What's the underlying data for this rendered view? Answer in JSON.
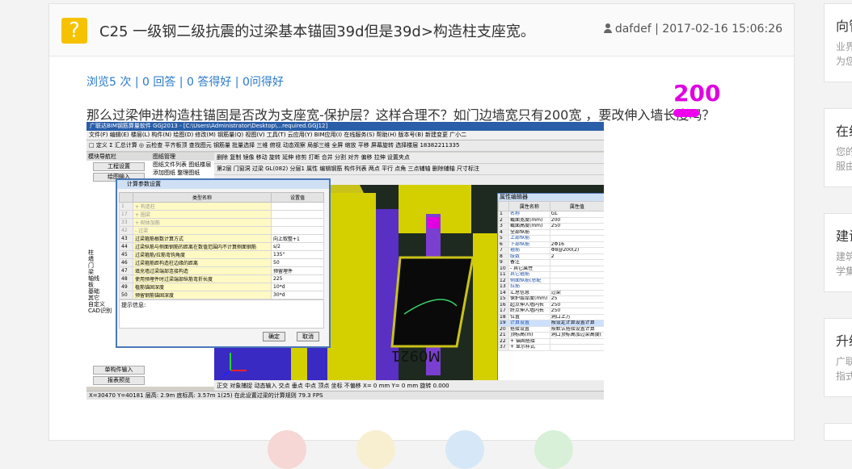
{
  "question": {
    "title": "C25 一级钢二级抗震的过梁基本锚固39d但是39d>构造柱支座宽。",
    "author": "dafdef",
    "separator": "|",
    "datetime": "2017-02-16 15:06:26",
    "stats": {
      "views": "浏览5 次",
      "answers": "0 回答",
      "good_answers": "0 答得好",
      "helpful": "0问得好",
      "sep": "|"
    },
    "body": "那么过梁伸进构造柱锚固是否改为支座宽-保护层？这样合理不？如门边墙宽只有200宽 ，要改伸入墙长度吗？",
    "annotation": "200"
  },
  "screenshot": {
    "titlebar": "广联达BIM钢筋算量软件 GGJ2013 - [C:\\Users\\Administrator\\Desktop\\...required.GGJ12]",
    "menubar": "文件(F)  编辑(E)  楼层(L)  构件(N)  绘图(D)  修改(M)  钢筋量(Q)  视图(V)  工具(T)  云应用(Y)  BIM应用(I)  在线服务(S)  帮助(H)  版本号(B)  新建变更  广小二",
    "toolbar1": "□ 定义  Σ 汇总计算  ◎ 云检查  平齐板顶  查找图元  钢筋量  批量选择  三维  俯视  动态观察  局部三维  全屏  缩放  平移  屏幕旋转  选择楼层",
    "phone": "18382211335",
    "leftpanel": {
      "header": "模块导航栏",
      "btn1": "工程设置",
      "btn2": "绘图输入",
      "tree": [
        "柱",
        "墙",
        "门",
        "梁",
        "轴线",
        "板",
        "基础",
        "其它",
        "自定义",
        "CAD识别"
      ],
      "bottom1": "单构件输入",
      "bottom2": "报表预览"
    },
    "midpanel": {
      "header": "图纸管理",
      "row": "图纸文件列表  图纸楼层",
      "btn": "添加图纸  整理图纸"
    },
    "vptoolbar": {
      "row1": "删除  复制  镜像  移动  旋转  延伸  修剪  打断  合并  分割  对齐  偏移  拉伸  设置夹点",
      "row2": "第2层  门窗洞  过梁  GL(082)  分层1  属性  编辑钢筋  构件列表  两点  平行  点角  三点辅轴  删除辅轴  尺寸标注"
    },
    "dialog": {
      "title": "计算参数设置",
      "col_name": "类型名称",
      "col_value": "设置值",
      "rows": [
        {
          "id": "1",
          "name": "+ 构造柱",
          "value": "",
          "group": true
        },
        {
          "id": "17",
          "name": "+ 圈梁",
          "value": "",
          "group": true
        },
        {
          "id": "33",
          "name": "+ 砌体加筋",
          "value": "",
          "group": true
        },
        {
          "id": "42",
          "name": "- 过梁",
          "value": "",
          "group": true
        },
        {
          "id": "43",
          "name": "过梁箍筋根数计算方式",
          "value": "向上取整+1"
        },
        {
          "id": "44",
          "name": "过梁纵筋与侧面钢筋的距离在数值范围内不计算侧面钢筋",
          "value": "s/2"
        },
        {
          "id": "45",
          "name": "过梁箍筋/拉筋弯钩角度",
          "value": "135°"
        },
        {
          "id": "46",
          "name": "过梁箍筋距构造柱边缘的距离",
          "value": "50"
        },
        {
          "id": "47",
          "name": "填充墙过梁端部连接构造",
          "value": "预留埋件"
        },
        {
          "id": "48",
          "name": "使用预埋件时过梁端部纵筋弯折长度",
          "value": "225"
        },
        {
          "id": "49",
          "name": "植筋锚固深度",
          "value": "10*d"
        },
        {
          "id": "50",
          "name": "预留钢筋锚固深度",
          "value": "30*d"
        }
      ],
      "hint": "提示信息:",
      "ok": "确定",
      "cancel": "取消"
    },
    "props": {
      "title": "属性编辑器",
      "col_name": "属性名称",
      "col_value": "属性值",
      "rows": [
        {
          "i": "1",
          "n": "名称",
          "v": "GL",
          "b": true
        },
        {
          "i": "2",
          "n": "截面宽度(mm)",
          "v": "200",
          "b": false
        },
        {
          "i": "3",
          "n": "截面高度(mm)",
          "v": "250",
          "b": false
        },
        {
          "i": "4",
          "n": "全部纵筋",
          "v": "",
          "b": false
        },
        {
          "i": "5",
          "n": "上部纵筋",
          "v": "",
          "b": true
        },
        {
          "i": "6",
          "n": "下部纵筋",
          "v": "2Φ16",
          "b": true
        },
        {
          "i": "7",
          "n": "箍筋",
          "v": "Φ8@200(2)",
          "b": true
        },
        {
          "i": "8",
          "n": "肢数",
          "v": "2",
          "b": true
        },
        {
          "i": "9",
          "n": "备注",
          "v": "",
          "b": false
        },
        {
          "i": "10",
          "n": "- 其它属性",
          "v": "",
          "b": false
        },
        {
          "i": "11",
          "n": "其它箍筋",
          "v": "",
          "b": true
        },
        {
          "i": "12",
          "n": "侧面纵筋(总配",
          "v": "",
          "b": true
        },
        {
          "i": "13",
          "n": "拉筋",
          "v": "",
          "b": true
        },
        {
          "i": "14",
          "n": "汇总信息",
          "v": "过梁",
          "b": false
        },
        {
          "i": "15",
          "n": "保护层厚度(mm)",
          "v": "25",
          "b": false
        },
        {
          "i": "16",
          "n": "起点伸入墙内长",
          "v": "250",
          "b": false
        },
        {
          "i": "17",
          "n": "终点伸入墙内长",
          "v": "250",
          "b": false
        },
        {
          "i": "18",
          "n": "位置",
          "v": "洞口上方",
          "b": false
        },
        {
          "i": "19",
          "n": "计算设置",
          "v": "按设定计算设置计算",
          "b": true,
          "sel": true
        },
        {
          "i": "20",
          "n": "搭接设置",
          "v": "按默认搭接设置计算",
          "b": false
        },
        {
          "i": "21",
          "n": "顶标高(m)",
          "v": "洞口顶标高加过梁高度(",
          "b": false
        },
        {
          "i": "22",
          "n": "+ 锚固搭接",
          "v": "",
          "b": false
        },
        {
          "i": "37",
          "n": "+ 显示样式",
          "v": "",
          "b": false
        }
      ]
    },
    "vpbottom": "正交  对象捕捉  动态输入  交点  垂点  中点  顶点  坐标  不偏移  X= 0 mm  Y= 0 mm  旋转 0.000",
    "statusbar": "X=30470 Y=40181    层高: 2.9m    底标高: 3.57m    1(25)    在此设置过梁的计算规则                                    79.3 FPS",
    "viewport_label": "M0921"
  },
  "sidebar": [
    {
      "title": "向管",
      "sub1": "业界",
      "sub2": "为您"
    },
    {
      "title": "在线",
      "sub1": "您的",
      "sub2": "服由"
    },
    {
      "title": "建设",
      "sub1": "建筑",
      "sub2": "学集"
    },
    {
      "title": "升级",
      "sub1": "广联",
      "sub2": "指式"
    }
  ],
  "colors": {
    "accent_link": "#2a7ac7",
    "icon_yellow": "#f6c200",
    "annotation_magenta": "#e000e0"
  }
}
